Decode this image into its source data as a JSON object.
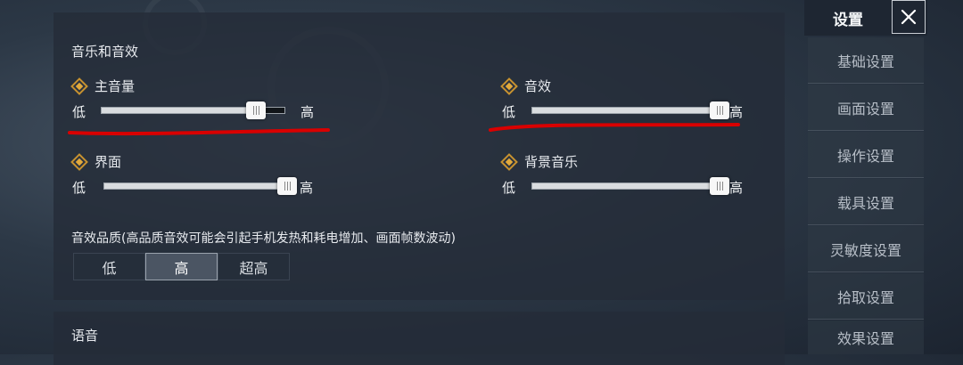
{
  "audio_section": {
    "title": "音乐和音效",
    "main_volume": {
      "label": "主音量",
      "low": "低",
      "high": "高",
      "value": 0.88
    },
    "sound_effects": {
      "label": "音效",
      "low": "低",
      "high": "高",
      "value": 1.0
    },
    "interface": {
      "label": "界面",
      "low": "低",
      "high": "高",
      "value": 1.0
    },
    "background_music": {
      "label": "背景音乐",
      "low": "低",
      "high": "高",
      "value": 1.0
    },
    "quality": {
      "label": "音效品质(高品质音效可能会引起手机发热和耗电增加、画面帧数波动)",
      "options": [
        "低",
        "高",
        "超高"
      ],
      "selected": "高"
    }
  },
  "voice_section": {
    "title": "语音"
  },
  "sidebar": {
    "title": "设置",
    "close_icon": "close-icon",
    "items": [
      "基础设置",
      "画面设置",
      "操作设置",
      "载具设置",
      "灵敏度设置",
      "拾取设置",
      "效果设置"
    ]
  },
  "colors": {
    "accent_diamond": "#e2aa3c",
    "annotation_red": "#d90000"
  }
}
